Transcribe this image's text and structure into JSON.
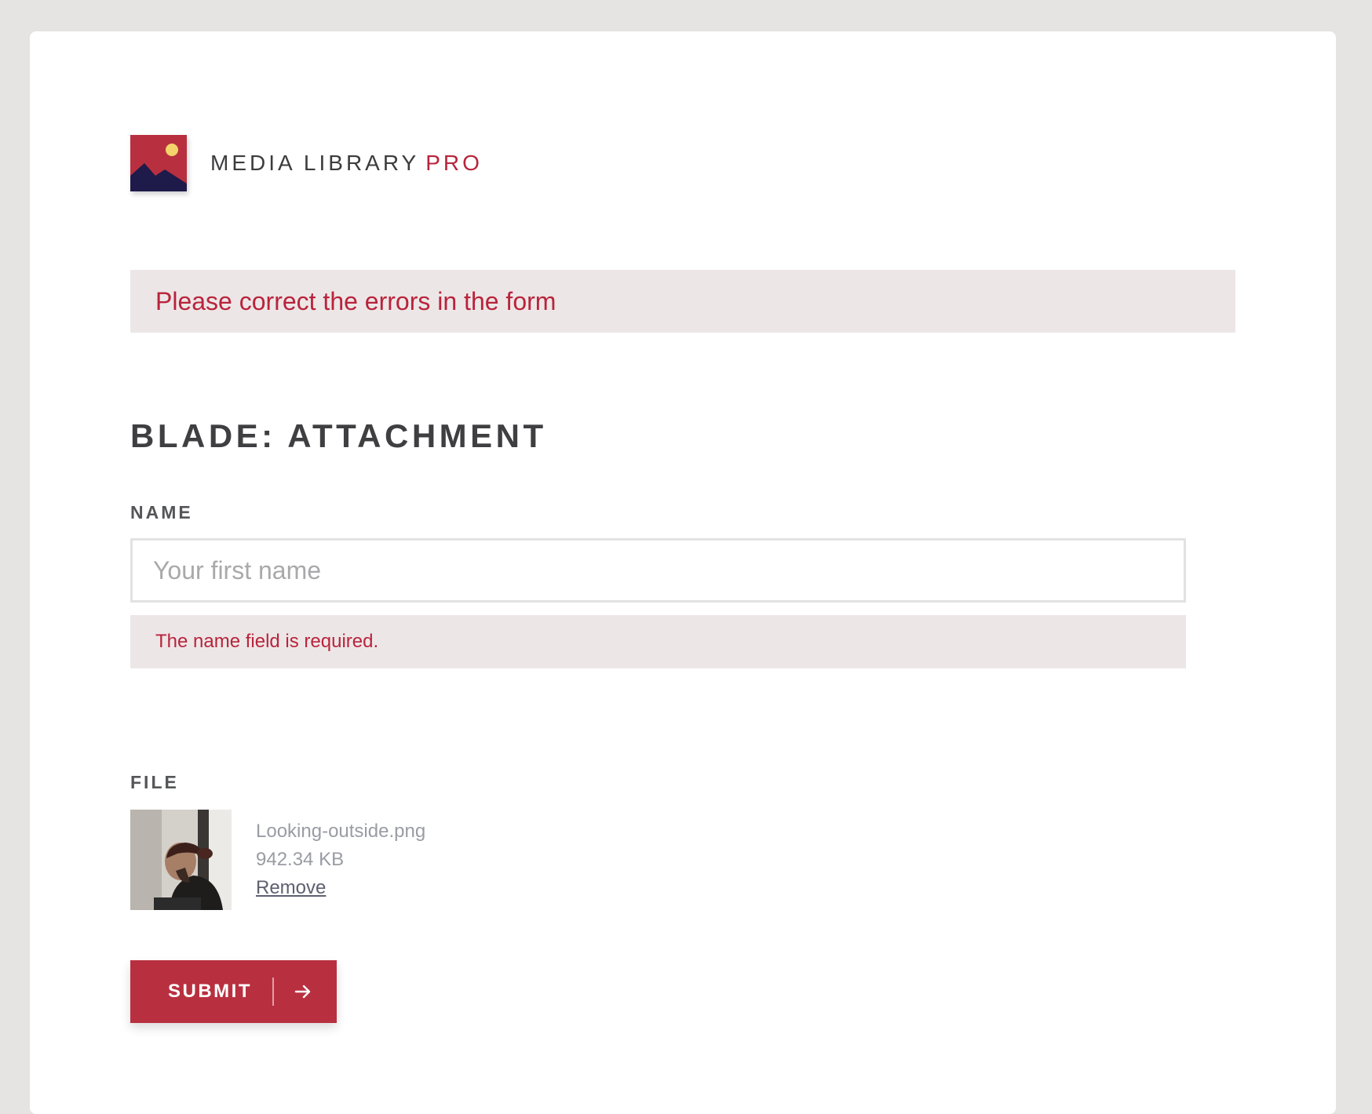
{
  "brand": {
    "name": "MEDIA LIBRARY",
    "suffix": "PRO",
    "accent_color": "#b8243b"
  },
  "form_error": "Please correct the errors in the form",
  "form_title": "BLADE: ATTACHMENT",
  "name_field": {
    "label": "NAME",
    "value": "",
    "placeholder": "Your first name",
    "error": "The name field is required."
  },
  "file_field": {
    "label": "FILE",
    "file_name": "Looking-outside.png",
    "file_size": "942.34 KB",
    "remove_label": "Remove"
  },
  "submit": {
    "label": "SUBMIT",
    "icon": "arrow-right-icon",
    "color": "#b8303f"
  }
}
